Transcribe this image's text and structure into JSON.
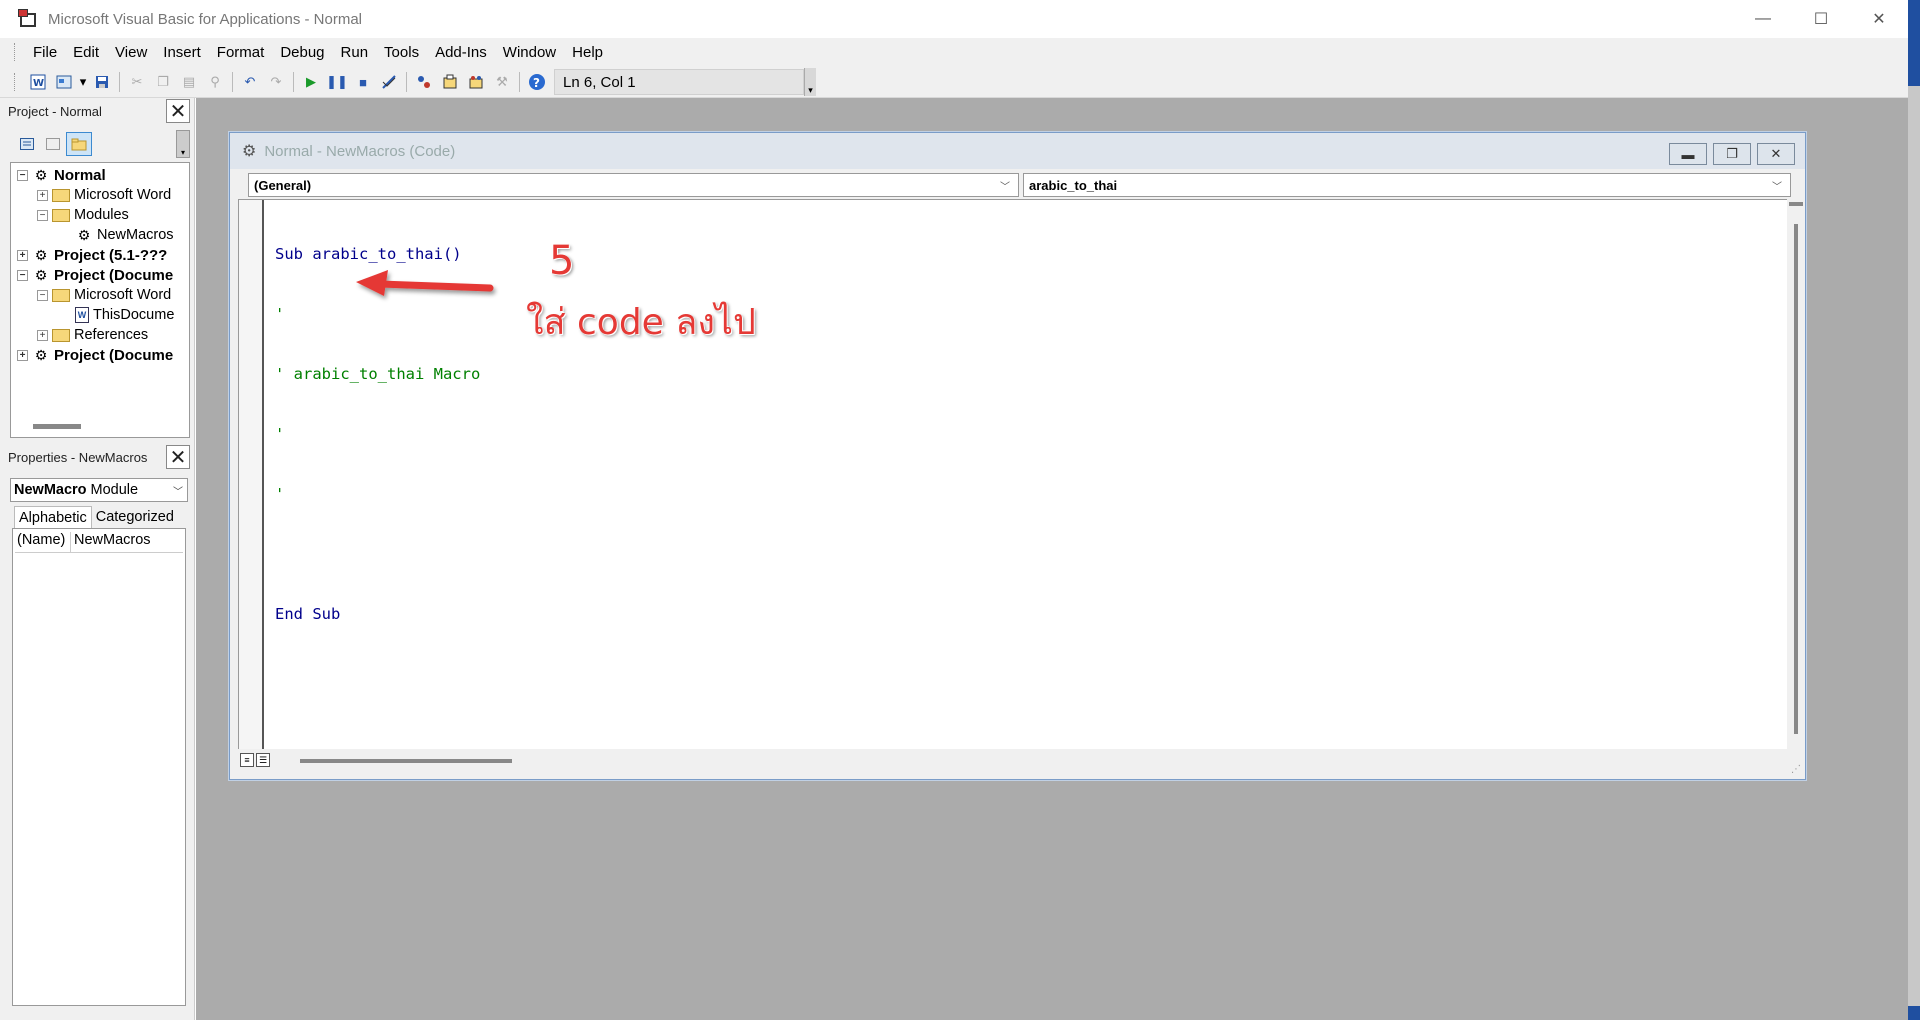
{
  "window": {
    "title": "Microsoft Visual Basic for Applications - Normal",
    "controls": {
      "minimize": "—",
      "maximize": "☐",
      "close": "✕"
    }
  },
  "menu": [
    {
      "label": "File"
    },
    {
      "label": "Edit"
    },
    {
      "label": "View"
    },
    {
      "label": "Insert"
    },
    {
      "label": "Format"
    },
    {
      "label": "Debug"
    },
    {
      "label": "Run"
    },
    {
      "label": "Tools"
    },
    {
      "label": "Add-Ins"
    },
    {
      "label": "Window"
    },
    {
      "label": "Help"
    }
  ],
  "toolbar": {
    "status": "Ln 6, Col 1",
    "icons": [
      "word-icon",
      "insert-userform-icon",
      "save-icon",
      "cut-icon",
      "copy-icon",
      "paste-icon",
      "find-icon",
      "undo-icon",
      "redo-icon",
      "run-icon",
      "break-icon",
      "reset-icon",
      "design-mode-icon",
      "project-explorer-icon",
      "properties-icon",
      "object-browser-icon",
      "toolbox-icon",
      "help-icon"
    ]
  },
  "project_panel": {
    "title": "Project - Normal",
    "tree": [
      {
        "label": "Normal",
        "bold": true
      },
      {
        "label": "Microsoft Word"
      },
      {
        "label": "Modules"
      },
      {
        "label": "NewMacros"
      },
      {
        "label": "Project (5.1-???",
        "bold": true
      },
      {
        "label": "Project (Docume",
        "bold": true
      },
      {
        "label": "Microsoft Word"
      },
      {
        "label": "ThisDocume"
      },
      {
        "label": "References"
      },
      {
        "label": "Project (Docume",
        "bold": true
      }
    ]
  },
  "properties_panel": {
    "title": "Properties - NewMacros",
    "object_name": "NewMacro",
    "object_type": "Module",
    "tabs": [
      "Alphabetic",
      "Categorized"
    ],
    "rows": [
      {
        "key": "(Name)",
        "value": "NewMacros"
      }
    ]
  },
  "code_window": {
    "title": "Normal - NewMacros (Code)",
    "object_combo": "(General)",
    "procedure_combo": "arabic_to_thai",
    "lines": [
      {
        "text": "Sub arabic_to_thai()",
        "kind": "kw"
      },
      {
        "text": "'",
        "kind": "cm"
      },
      {
        "text": "' arabic_to_thai Macro",
        "kind": "cm"
      },
      {
        "text": "'",
        "kind": "cm"
      },
      {
        "text": "'",
        "kind": "cm"
      },
      {
        "text": "",
        "kind": "plain"
      },
      {
        "text": "End Sub",
        "kind": "kw"
      }
    ]
  },
  "annotation": {
    "step": "5",
    "text": "ใส่ code ลงไป",
    "color": "#e53935"
  }
}
